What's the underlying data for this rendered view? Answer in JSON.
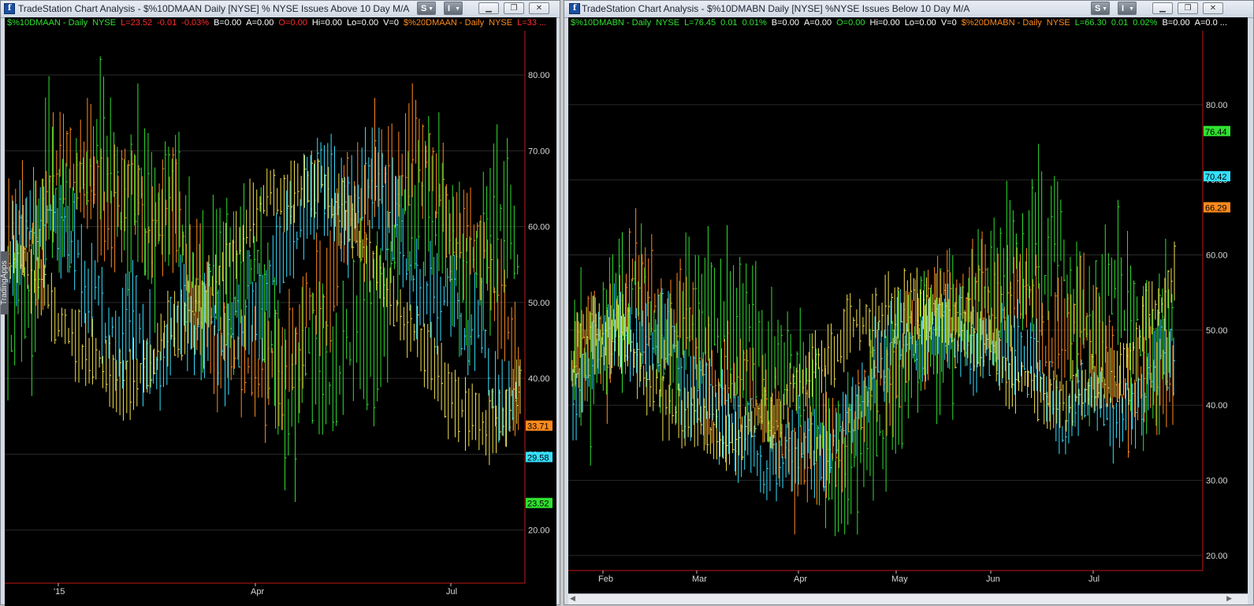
{
  "left": {
    "title": "TradeStation Chart Analysis - $%10DMAAN Daily [NYSE] % NYSE Issues Above 10 Day M/A",
    "btn_s": "S",
    "btn_i": "I",
    "status": [
      {
        "text": "$%10DMAAN - Daily",
        "color": "#2fe02f"
      },
      {
        "text": "NYSE",
        "color": "#2fe02f"
      },
      {
        "text": "L=23.52",
        "color": "#ff2b2b"
      },
      {
        "text": "-0.01",
        "color": "#ff2b2b"
      },
      {
        "text": "-0.03%",
        "color": "#ff2b2b"
      },
      {
        "text": "B=0.00",
        "color": "#ffffff"
      },
      {
        "text": "A=0.00",
        "color": "#ffffff"
      },
      {
        "text": "O=0.00",
        "color": "#ff2b2b"
      },
      {
        "text": "Hi=0.00",
        "color": "#ffffff"
      },
      {
        "text": "Lo=0.00",
        "color": "#ffffff"
      },
      {
        "text": "V=0",
        "color": "#ffffff"
      },
      {
        "text": "$%20DMAAN - Daily",
        "color": "#ff8a1c"
      },
      {
        "text": "NYSE",
        "color": "#ff8a1c"
      },
      {
        "text": "L=33 ...",
        "color": "#ff2b2b"
      }
    ],
    "side_tab": "TradingApps",
    "y_labels": [
      "80.00",
      "70.00",
      "60.00",
      "50.00",
      "40.00",
      "30.00",
      "20.00"
    ],
    "x_labels": [
      "'15",
      "Apr",
      "Jul"
    ],
    "price_tags": [
      {
        "value": "33.71",
        "bg": "#ff8a1c"
      },
      {
        "value": "29.58",
        "bg": "#35e0ff"
      },
      {
        "value": "23.52",
        "bg": "#2fe02f"
      }
    ]
  },
  "right": {
    "title": "TradeStation Chart Analysis - $%10DMABN Daily [NYSE] %NYSE Issues Below 10 Day M/A",
    "btn_s": "S",
    "btn_i": "I",
    "status": [
      {
        "text": "$%10DMABN - Daily",
        "color": "#2fe02f"
      },
      {
        "text": "NYSE",
        "color": "#2fe02f"
      },
      {
        "text": "L=76.45",
        "color": "#2fe02f"
      },
      {
        "text": "0.01",
        "color": "#2fe02f"
      },
      {
        "text": "0.01%",
        "color": "#2fe02f"
      },
      {
        "text": "B=0.00",
        "color": "#ffffff"
      },
      {
        "text": "A=0.00",
        "color": "#ffffff"
      },
      {
        "text": "O=0.00",
        "color": "#2fe02f"
      },
      {
        "text": "Hi=0.00",
        "color": "#ffffff"
      },
      {
        "text": "Lo=0.00",
        "color": "#ffffff"
      },
      {
        "text": "V=0",
        "color": "#ffffff"
      },
      {
        "text": "$%20DMABN - Daily",
        "color": "#ff8a1c"
      },
      {
        "text": "NYSE",
        "color": "#ff8a1c"
      },
      {
        "text": "L=66.30",
        "color": "#2fe02f"
      },
      {
        "text": "0.01",
        "color": "#2fe02f"
      },
      {
        "text": "0.02%",
        "color": "#2fe02f"
      },
      {
        "text": "B=0.00",
        "color": "#ffffff"
      },
      {
        "text": "A=0.0 ...",
        "color": "#ffffff"
      }
    ],
    "y_labels": [
      "80.00",
      "70.00",
      "60.00",
      "50.00",
      "40.00",
      "30.00",
      "20.00"
    ],
    "x_labels": [
      "Feb",
      "Mar",
      "Apr",
      "May",
      "Jun",
      "Jul"
    ],
    "price_tags": [
      {
        "value": "76.44",
        "bg": "#2fe02f"
      },
      {
        "value": "70.42",
        "bg": "#35e0ff"
      },
      {
        "value": "66.29",
        "bg": "#ff8a1c"
      }
    ]
  },
  "chart_data": [
    {
      "type": "bar",
      "title": "",
      "ylim": [
        13,
        85
      ],
      "series": [
        {
          "values_last": 23.52,
          "color": "#2fe02f"
        },
        {
          "values_last": 33.71,
          "color": "#ff8a1c"
        },
        {
          "values_last": 29.58,
          "color": "#35e0ff"
        }
      ]
    },
    {
      "type": "bar",
      "title": "",
      "ylim": [
        18,
        89
      ],
      "series": [
        {
          "values_last": 76.44,
          "color": "#2fe02f"
        },
        {
          "values_last": 66.29,
          "color": "#ff8a1c"
        },
        {
          "values_last": 70.42,
          "color": "#35e0ff"
        }
      ]
    }
  ],
  "colors": {
    "green": "#2fe02f",
    "orange": "#ff8a1c",
    "cyan": "#35e0ff",
    "yellow": "#f4e04a",
    "axis_red": "#c41818"
  }
}
